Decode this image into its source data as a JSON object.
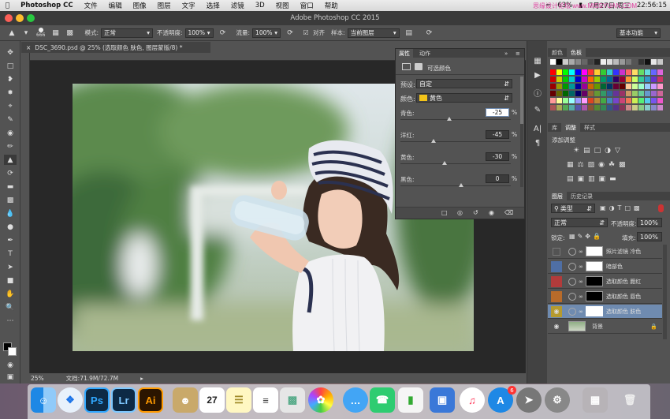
{
  "menubar": {
    "apple": "",
    "app": "Photoshop CC",
    "menus": [
      "文件",
      "编辑",
      "图像",
      "图层",
      "文字",
      "选择",
      "滤镜",
      "3D",
      "视图",
      "窗口",
      "帮助"
    ],
    "battery": "63%",
    "date": "7月27日 周三",
    "time": "22:56:15"
  },
  "window": {
    "title": "Adobe Photoshop CC 2015"
  },
  "options": {
    "brush_size": "666",
    "mode_label": "模式:",
    "mode_value": "正常",
    "opacity_label": "不透明度:",
    "opacity_value": "100%",
    "flow_label": "流量:",
    "flow_value": "100%",
    "aligned_label": "对齐",
    "sample_label": "样本:",
    "sample_value": "当前图层",
    "workspace": "基本功能"
  },
  "document": {
    "tab": "DSC_3690.psd @ 25% (选取颜色 肤色, 图层蒙版/8) *",
    "zoom": "25%",
    "doc_info": "文档:71.9M/72.7M"
  },
  "properties": {
    "tabs": [
      "属性",
      "动作"
    ],
    "panel_title": "可选颜色",
    "preset_label": "预设:",
    "preset_value": "自定",
    "colors_label": "颜色:",
    "colors_value": "黄色",
    "sliders": [
      {
        "label": "青色:",
        "value": "-25",
        "fraction": 0.44
      },
      {
        "label": "洋红:",
        "value": "-45",
        "fraction": 0.3
      },
      {
        "label": "黄色:",
        "value": "-30",
        "fraction": 0.4
      },
      {
        "label": "黑色:",
        "value": "0",
        "fraction": 0.55
      }
    ],
    "percent": "%"
  },
  "panels": {
    "swatch_tabs": [
      "颜色",
      "色板"
    ],
    "adjust_tabs": [
      "库",
      "调整",
      "样式"
    ],
    "adjust_title": "添加调整",
    "layer_tabs": [
      "图层",
      "历史记录"
    ],
    "kind_label": "类型",
    "blend_value": "正常",
    "opacity_label": "不透明度:",
    "opacity_value": "100%",
    "lock_label": "锁定:",
    "fill_label": "填充:",
    "fill_value": "100%",
    "layers": [
      {
        "name": "照片滤镜 冷色",
        "color": "#555555",
        "mask": "#ffffff"
      },
      {
        "name": "暗部色",
        "color": "#4f6fa5",
        "mask": "#ffffff"
      },
      {
        "name": "选取颜色 腮红",
        "color": "#b23b3b",
        "mask": "#000000"
      },
      {
        "name": "选取颜色 唇色",
        "color": "#b86b2a",
        "mask": "#000000"
      },
      {
        "name": "选取颜色 肤色",
        "color": "#b59a2e",
        "mask": "#ffffff",
        "selected": true
      },
      {
        "name": "背景",
        "color": "#555555",
        "mask": "#ffffff",
        "is_bg": true
      }
    ]
  },
  "dock": {
    "apps": [
      "Finder",
      "Safari",
      "Ps",
      "Lr",
      "Ai",
      "Contacts",
      "27",
      "Notes",
      "Reminders",
      "Preview",
      "Photos",
      "Messages",
      "FaceTime",
      "Numbers",
      "Keynote",
      "iTunes",
      "App Store",
      "Rocket",
      "System Preferences",
      "Trash"
    ],
    "calendar_day": "27",
    "appstore_badge": "6"
  },
  "watermark": "思缘设计论坛 www.MISSYUAN.COM",
  "colors": {
    "accent": "#6f8bb0",
    "panel": "#535353",
    "dark": "#282828"
  }
}
